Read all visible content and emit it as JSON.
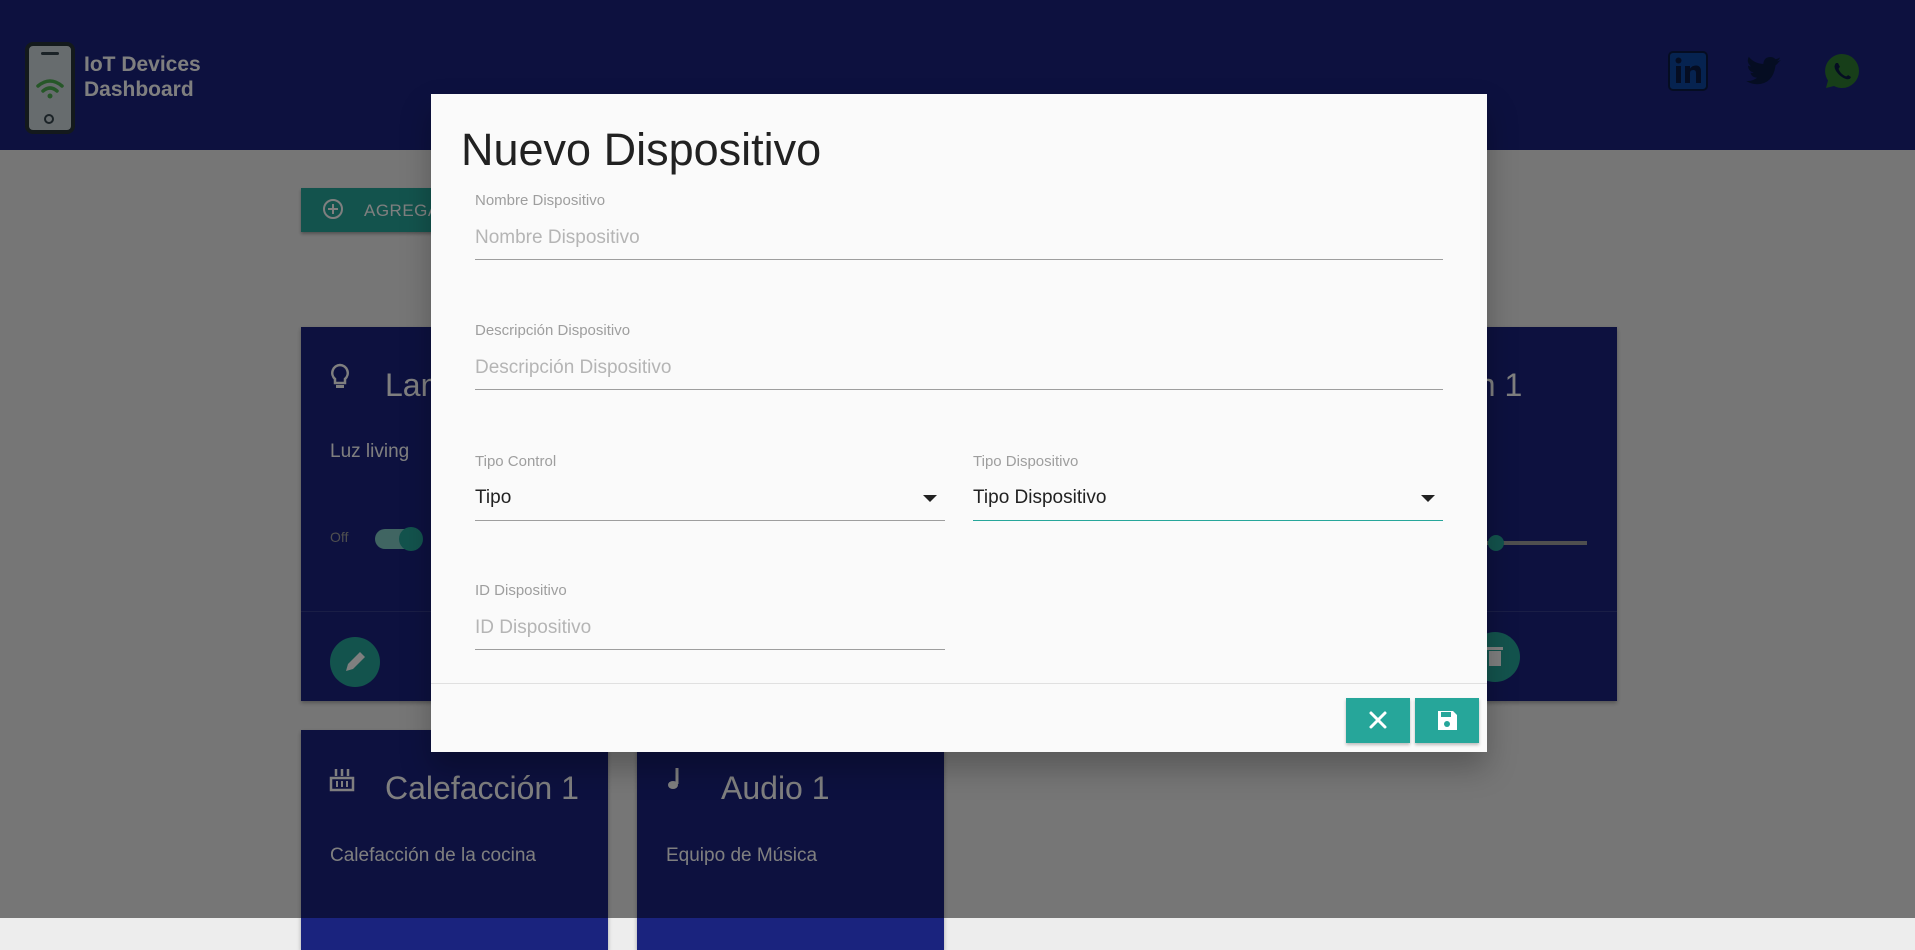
{
  "header": {
    "title_line1": "IoT Devices",
    "title_line2": "Dashboard",
    "social": [
      "linkedin-icon",
      "twitter-icon",
      "whatsapp-icon"
    ]
  },
  "main": {
    "add_button_label": "AGREGA"
  },
  "cards": [
    {
      "title": "Lam",
      "desc": "Luz living",
      "icon": "lightbulb-icon",
      "toggle_off_label": "Off"
    },
    {
      "title": "ón 1",
      "icon": "trash-icon"
    },
    {
      "title": "Calefacción 1",
      "desc": "Calefacción de la cocina",
      "icon": "heater-icon"
    },
    {
      "title": "Audio 1",
      "desc": "Equipo de Música",
      "icon": "music-note-icon"
    }
  ],
  "modal": {
    "title": "Nuevo Dispositivo",
    "fields": {
      "name": {
        "label": "Nombre Dispositivo",
        "placeholder": "Nombre Dispositivo"
      },
      "description": {
        "label": "Descripción Dispositivo",
        "placeholder": "Descripción Dispositivo"
      },
      "control_type": {
        "label": "Tipo Control",
        "value": "Tipo"
      },
      "device_type": {
        "label": "Tipo Dispositivo",
        "value": "Tipo Dispositivo"
      },
      "device_id": {
        "label": "ID Dispositivo",
        "placeholder": "ID Dispositivo"
      }
    },
    "buttons": {
      "cancel_icon": "close-icon",
      "save_icon": "save-icon"
    }
  },
  "colors": {
    "header_bg": "#1a237e",
    "accent": "#26a69a",
    "card_bg": "#1a237e"
  }
}
